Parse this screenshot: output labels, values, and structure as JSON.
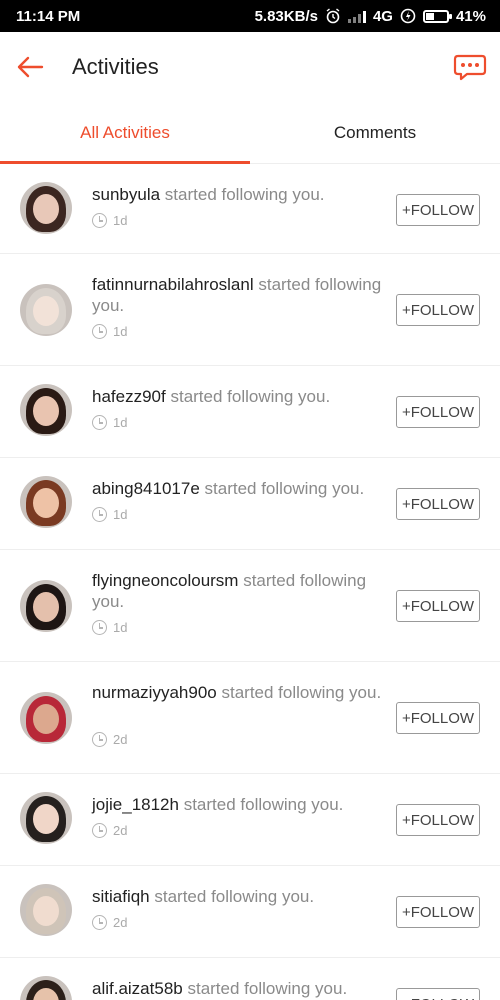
{
  "status_bar": {
    "time": "11:14 PM",
    "network_speed": "5.83KB/s",
    "network_type": "4G",
    "battery": "41%",
    "icons": [
      "alarm-icon",
      "signal-icon",
      "data-saver-icon",
      "battery-icon"
    ]
  },
  "app_bar": {
    "title": "Activities",
    "back_icon": "arrow-left-icon",
    "chat_icon": "chat-bubbles-icon",
    "accent_color": "#ee4d2d"
  },
  "tabs": [
    {
      "label": "All Activities",
      "active": true
    },
    {
      "label": "Comments",
      "active": false
    }
  ],
  "activity_text": "started following you.",
  "follow_label": "+FOLLOW",
  "activities": [
    {
      "username": "sunbyula",
      "time": "1d"
    },
    {
      "username": "fatinnurnabilahroslanl",
      "time": "1d"
    },
    {
      "username": "hafezz90f",
      "time": "1d"
    },
    {
      "username": "abing841017e",
      "time": "1d"
    },
    {
      "username": "flyingneoncoloursm",
      "time": "1d"
    },
    {
      "username": "nurmaziyyah90o",
      "time": "2d"
    },
    {
      "username": "jojie_1812h",
      "time": "2d"
    },
    {
      "username": "sitiafiqh",
      "time": "2d"
    },
    {
      "username": "alif.aizat58b",
      "time": ""
    }
  ]
}
